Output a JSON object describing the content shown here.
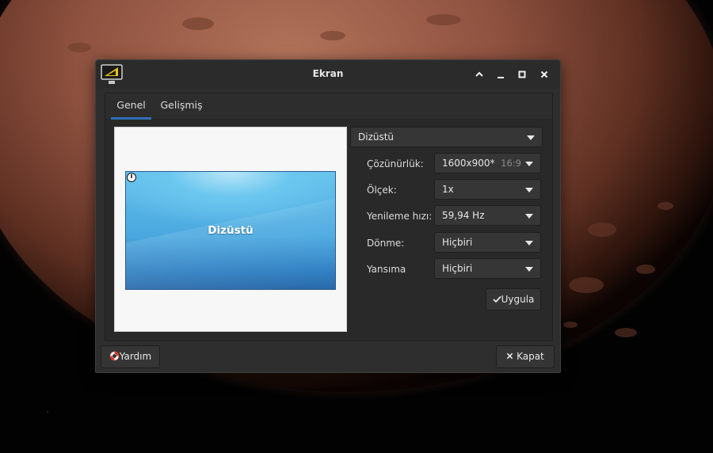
{
  "window": {
    "title": "Ekran"
  },
  "tabs": [
    {
      "label": "Genel",
      "active": true
    },
    {
      "label": "Gelişmiş",
      "active": false
    }
  ],
  "preview": {
    "display_name": "Dizüstü"
  },
  "display_select": {
    "value": "Dizüstü"
  },
  "settings": {
    "resolution": {
      "label": "Çözünürlük:",
      "value": "1600x900*",
      "ratio": "16:9"
    },
    "scale": {
      "label": "Ölçek:",
      "value": "1x"
    },
    "refresh": {
      "label": "Yenileme hızı:",
      "value": "59,94 Hz"
    },
    "rotation": {
      "label": "Dönme:",
      "value": "Hiçbiri"
    },
    "reflection": {
      "label": "Yansıma",
      "value": "Hiçbiri"
    }
  },
  "buttons": {
    "apply": "Uygula",
    "help": "Yardım",
    "close": "Kapat"
  },
  "colors": {
    "accent": "#2f6fb5",
    "window_bg": "#2e2e2e",
    "preview_screen": "#4aa8df"
  }
}
